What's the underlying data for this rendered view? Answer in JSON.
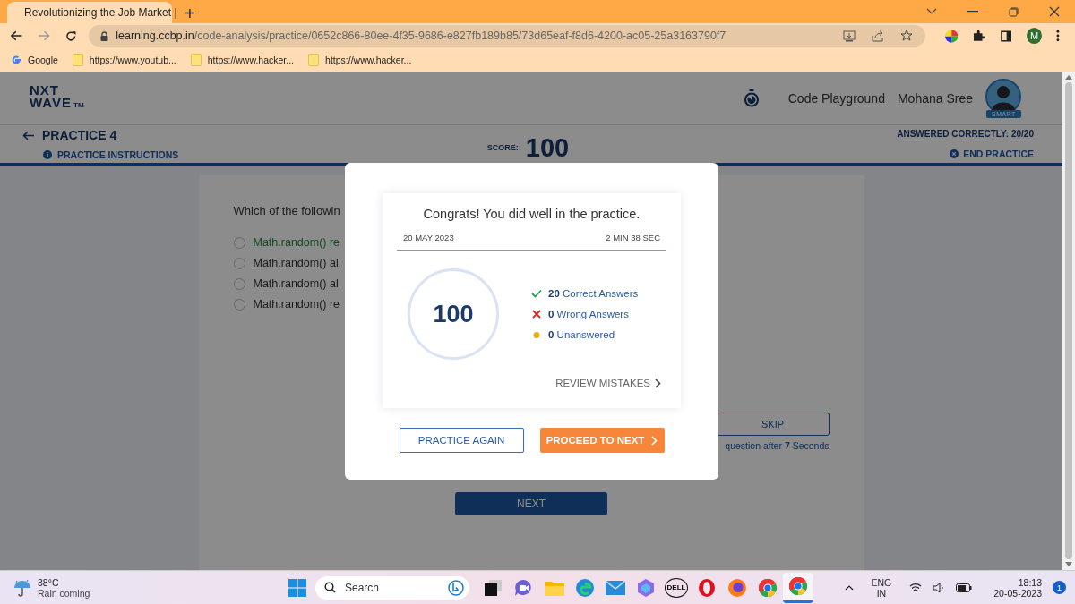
{
  "browser": {
    "tabs": [
      {
        "title": "Revolutionizing the Job Market |",
        "selected": true
      }
    ],
    "new_tab": "+",
    "address": {
      "host": "learning.ccbp.in",
      "path": "/code-analysis/practice/0652c866-80ee-4f35-9686-e827fb189b85/73d65eaf-f8d6-4200-ac05-25a3163790f7"
    },
    "profile": "M",
    "bookmarks": [
      {
        "kind": "google",
        "label": "Google"
      },
      {
        "kind": "folder",
        "label": "https://www.youtub..."
      },
      {
        "kind": "folder",
        "label": "https://www.hacker..."
      },
      {
        "kind": "folder",
        "label": "https://www.hacker..."
      }
    ]
  },
  "header": {
    "logo": {
      "line_1": "NXT",
      "line_2": "WAVE",
      "mark": "TM"
    },
    "link": "Code Playground",
    "user": "Mohana Sree",
    "badge": "SMART"
  },
  "practice": {
    "title": "PRACTICE 4",
    "instructions": "PRACTICE INSTRUCTIONS",
    "score_label": "SCORE:",
    "score": "100",
    "answered": "ANSWERED CORRECTLY: 20/20",
    "end": "END PRACTICE"
  },
  "question": {
    "text": "Which of the followin",
    "options": [
      {
        "text": "Math.random() re",
        "correct": true,
        "selected": false
      },
      {
        "text": "Math.random() al",
        "correct": false,
        "selected": false
      },
      {
        "text": "Math.random() al",
        "correct": false,
        "selected": false
      },
      {
        "text": "Math.random() re",
        "correct": false,
        "selected": false
      }
    ],
    "skip": "SKIP",
    "notice": "question after **7** Seconds",
    "next": "NEXT"
  },
  "modal": {
    "title": "Congrats! You did well in the practice.",
    "date": "20 MAY 2023",
    "duration": "2 MIN 38 SEC",
    "score": "100",
    "stats": [
      {
        "kind": "correct",
        "count": "20",
        "label": "Correct Answers"
      },
      {
        "kind": "wrong",
        "count": "0",
        "label": "Wrong Answers"
      },
      {
        "kind": "unanswered",
        "count": "0",
        "label": "Unanswered"
      }
    ],
    "review": "REVIEW MISTAKES",
    "buttons": [
      {
        "kind": "secondary",
        "label": "PRACTICE AGAIN"
      },
      {
        "kind": "primary",
        "label": "PROCEED TO NEXT"
      }
    ]
  },
  "taskbar": {
    "weather": {
      "temp": "38°C",
      "text": "Rain coming"
    },
    "search": "Search",
    "apps": [
      {
        "kind": "taskview",
        "selected": false
      },
      {
        "kind": "chat",
        "selected": false
      },
      {
        "kind": "files",
        "selected": false
      },
      {
        "kind": "edge",
        "selected": false
      },
      {
        "kind": "mail",
        "selected": false
      },
      {
        "kind": "copilot",
        "selected": false
      },
      {
        "kind": "dell",
        "label": "DELL",
        "selected": false
      },
      {
        "kind": "opera",
        "selected": false
      },
      {
        "kind": "firefox",
        "selected": false
      },
      {
        "kind": "chrome",
        "selected": false
      },
      {
        "kind": "chrome",
        "selected": true
      }
    ],
    "lang": "ENG",
    "region": "IN",
    "time": "18:13",
    "date": "20-05-2023",
    "notifications": "1"
  }
}
